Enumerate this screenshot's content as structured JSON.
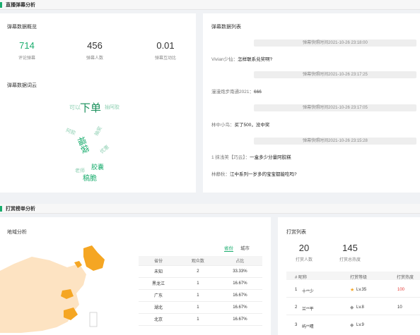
{
  "section1": {
    "title": "直播弹幕分析"
  },
  "overview": {
    "title": "弹幕数据概览",
    "stats": [
      {
        "value": "714",
        "label": "评论弹幕",
        "color": "#1aad6e"
      },
      {
        "value": "456",
        "label": "弹幕人数",
        "color": "#333333"
      },
      {
        "value": "0.01",
        "label": "弹幕互动比",
        "color": "#333333"
      }
    ]
  },
  "wordcloud": {
    "title": "弹幕数据词云",
    "words": [
      "下单",
      "可以",
      "抽阿胶",
      "阿胶",
      "抽奖",
      "福袋",
      "老师",
      "胶囊",
      "稿脆",
      "优惠"
    ]
  },
  "danmu_list": {
    "title": "弹幕数据列表",
    "items": [
      {
        "time": "弹幕快照时间2021-10-26 23:18:00",
        "user": "Vivian少仙：",
        "text": "怎样联系兑奖啊?"
      },
      {
        "time": "弹幕快照时间2021-10-26 23:17:25",
        "user": "漫漫炮步南通2021：",
        "text": "666"
      },
      {
        "time": "弹幕快照时间2021-10-26 23:17:05",
        "user": "林中小鸟：",
        "text": "买了500，没中奖"
      },
      {
        "time": "弹幕快照时间2021-10-26 23:15:28",
        "user": "1 抹浅笑【巧云】：",
        "text": "一盒多少分量阿胶糕"
      },
      {
        "time": "",
        "user": "林静秋：",
        "text": "江中系列一岁多的宝宝都能吃吗?"
      }
    ]
  },
  "section2": {
    "title": "打赏榜单分析"
  },
  "region": {
    "title": "地域分析",
    "tabs": [
      "省份",
      "城市"
    ],
    "headers": [
      "省份",
      "观众数",
      "占比"
    ],
    "rows": [
      [
        "未知",
        "2",
        "33.33%"
      ],
      [
        "黑龙江",
        "1",
        "16.67%"
      ],
      [
        "广东",
        "1",
        "16.67%"
      ],
      [
        "湖北",
        "1",
        "16.67%"
      ],
      [
        "北京",
        "1",
        "16.67%"
      ]
    ]
  },
  "reward": {
    "title": "打赏列表",
    "stats": [
      {
        "value": "20",
        "label": "打赏人数"
      },
      {
        "value": "145",
        "label": "打赏总热度"
      }
    ],
    "headers": [
      "# 昵称",
      "打赏等级",
      "打赏热度"
    ],
    "rows": [
      {
        "rank": "1",
        "name": "十**少",
        "level": "Lv.35",
        "heat": "100",
        "level_color": "#f5a623",
        "heat_color": "#e53935"
      },
      {
        "rank": "2",
        "name": "兰**平",
        "level": "Lv.8",
        "heat": "10",
        "level_color": "#999999",
        "heat_color": "#333333"
      },
      {
        "rank": "3",
        "name": "屿**晴",
        "level": "Lv.9",
        "heat": "",
        "level_color": "#999999",
        "heat_color": "#333333"
      }
    ]
  },
  "colors": {
    "accent": "#1aad6e",
    "map_hot": "#f5a623",
    "map_light": "#fde3c2"
  }
}
